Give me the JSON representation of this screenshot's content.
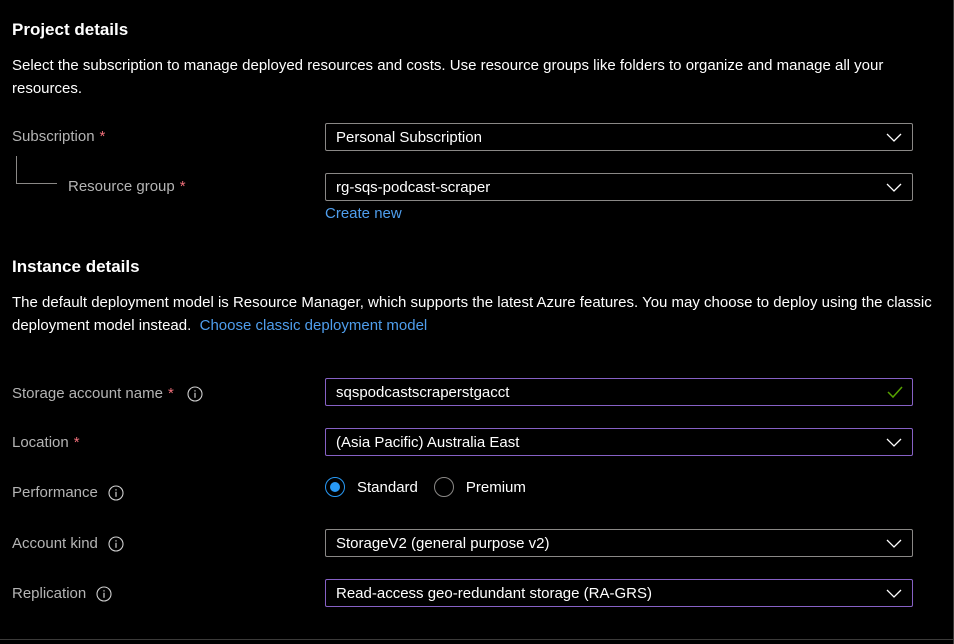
{
  "project_details": {
    "title": "Project details",
    "description": "Select the subscription to manage deployed resources and costs. Use resource groups like folders to organize and manage all your resources."
  },
  "subscription": {
    "label": "Subscription",
    "required_marker": "*",
    "value": "Personal Subscription"
  },
  "resource_group": {
    "label": "Resource group",
    "required_marker": "*",
    "value": "rg-sqs-podcast-scraper",
    "create_new": "Create new"
  },
  "instance_details": {
    "title": "Instance details",
    "description": "The default deployment model is Resource Manager, which supports the latest Azure features. You may choose to deploy using the classic deployment model instead.",
    "classic_link": "Choose classic deployment model"
  },
  "storage_account_name": {
    "label": "Storage account name",
    "required_marker": "*",
    "value": "sqspodcastscraperstgacct",
    "valid": true
  },
  "location": {
    "label": "Location",
    "required_marker": "*",
    "value": "(Asia Pacific) Australia East"
  },
  "performance": {
    "label": "Performance",
    "options": [
      "Standard",
      "Premium"
    ],
    "selected": "Standard"
  },
  "account_kind": {
    "label": "Account kind",
    "value": "StorageV2 (general purpose v2)"
  },
  "replication": {
    "label": "Replication",
    "value": "Read-access geo-redundant storage (RA-GRS)"
  },
  "icons": {
    "info": "info-icon",
    "chevron": "chevron-down-icon",
    "valid": "checkmark-icon"
  },
  "colors": {
    "background": "#000000",
    "link": "#4f9eed",
    "required": "#f1707b",
    "focus_border": "#8661c5",
    "radio_accent": "#2899f5",
    "valid_check": "#57a300"
  }
}
